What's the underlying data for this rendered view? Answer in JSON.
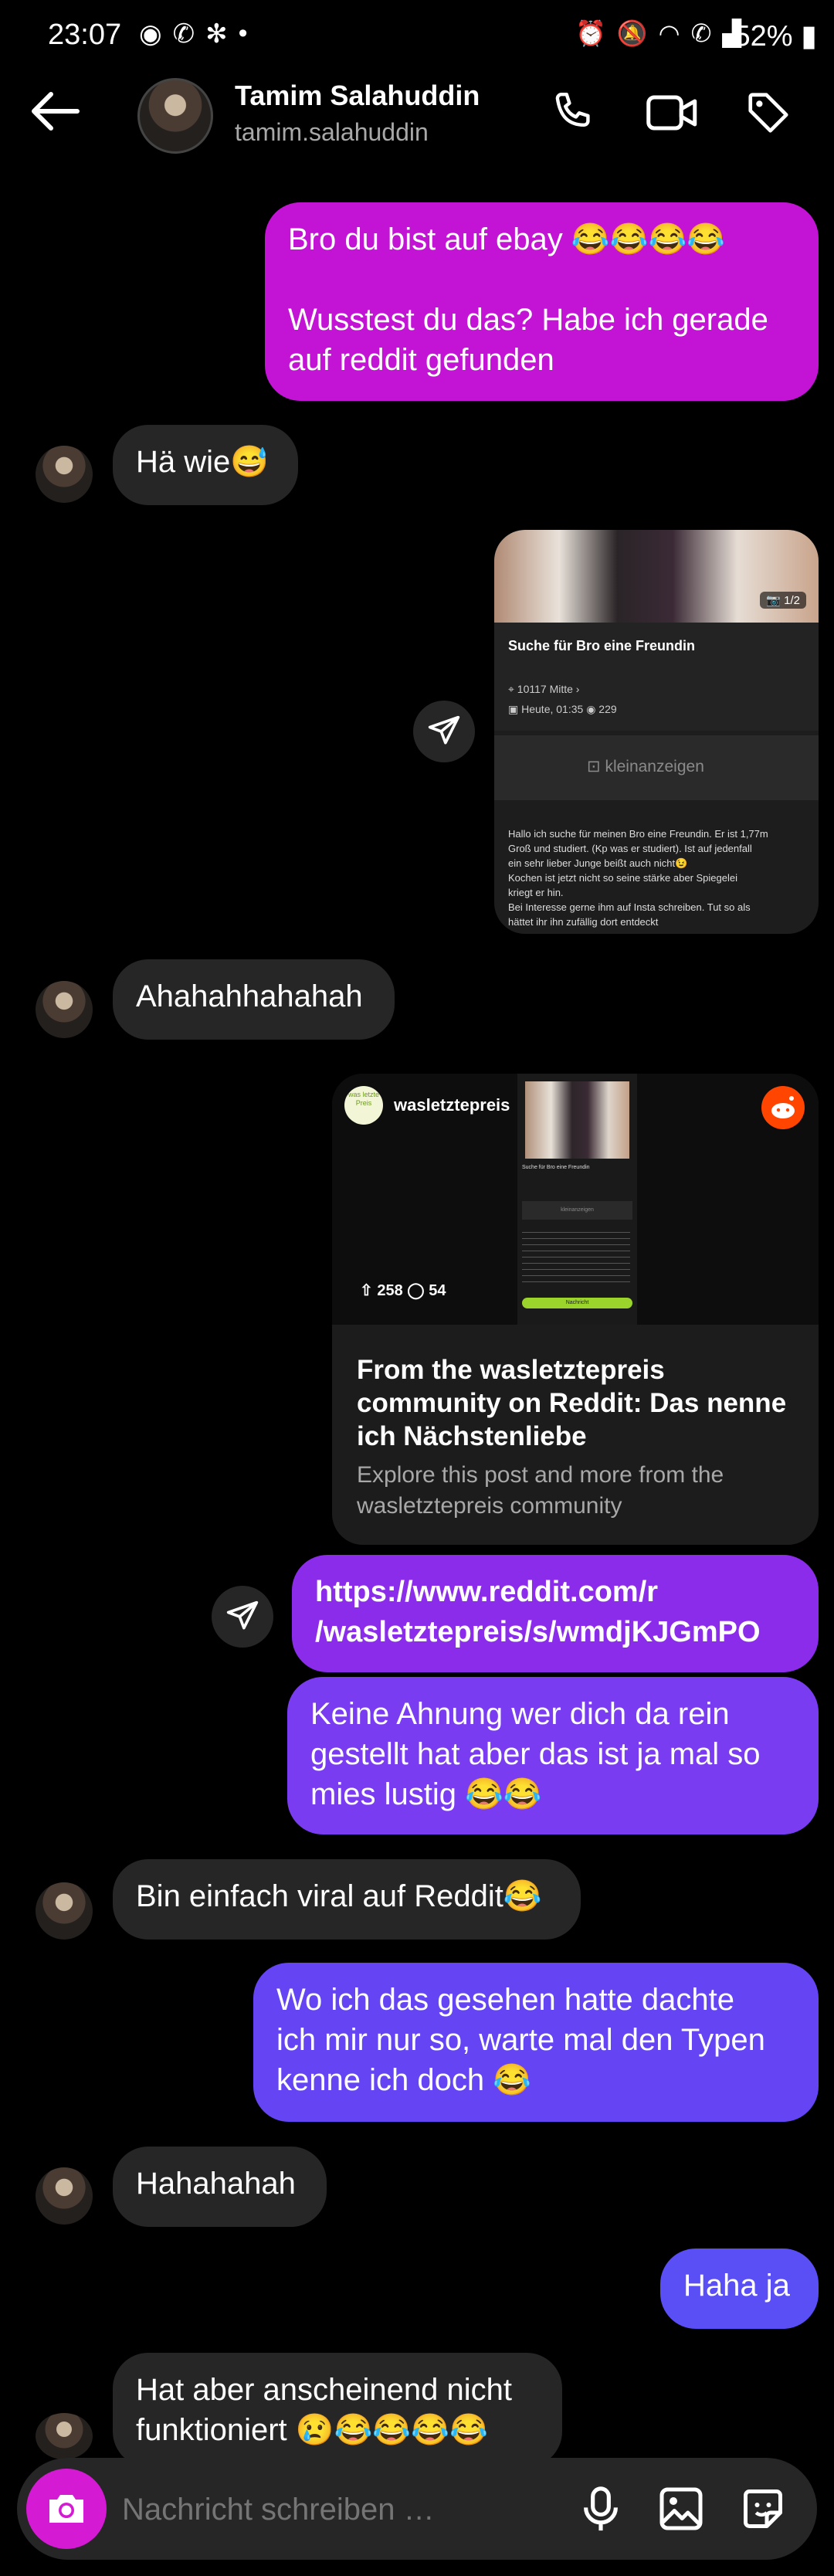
{
  "status_bar": {
    "time": "23:07",
    "battery": "52%"
  },
  "header": {
    "name": "Tamim Salahuddin",
    "username": "tamim.salahuddin"
  },
  "messages": {
    "m1_line1": "Bro du bist auf ebay 😂😂😂😂",
    "m1_line2": "Wusstest du das? Habe ich gerade",
    "m1_line3": "auf reddit gefunden",
    "m2": "Hä wie😅",
    "m3": "Ahahahhahahah",
    "m4_line1": "https://www.reddit.com/r",
    "m4_line2": "/wasletztepreis/s/wmdjKJGmPO",
    "m5_line1": "Keine Ahnung wer dich da rein",
    "m5_line2": "gestellt hat aber das ist ja mal so",
    "m5_line3": "mies lustig 😂😂",
    "m6": "Bin einfach viral auf Reddit😂",
    "m7_line1": "Wo ich das gesehen hatte dachte",
    "m7_line2": "ich mir nur so, warte mal den Typen",
    "m7_line3": "kenne ich doch 😂",
    "m8": "Hahahahah",
    "m9": "Haha ja",
    "m10_line1": "Hat aber anscheinend nicht",
    "m10_line2": "funktioniert 😢😂😂😂😂"
  },
  "ad_card": {
    "photo_counter": "1/2",
    "title": "Suche für Bro eine Freundin",
    "location": "10117 Mitte",
    "date": "Heute, 01:35",
    "views": "229",
    "brand": "kleinanzeigen",
    "body1": "Hallo ich suche für meinen Bro eine Freundin. Er ist 1,77m",
    "body2": "Groß und studiert. (Kp was er studiert). Ist auf jedenfall",
    "body3": "ein sehr lieber Junge beißt auch nicht😉",
    "body4": "Kochen ist jetzt nicht so seine stärke aber Spiegelei",
    "body5": "kriegt er hin.",
    "body6": "Bei Interesse gerne ihm auf Insta schreiben. Tut so als",
    "body7": "hättet ihr ihn zufällig dort entdeckt"
  },
  "reddit_card": {
    "community": "wasletztepreis",
    "community_avatar_text": "was letzte Preis",
    "upvotes": "258",
    "comments": "54",
    "title1": "From the wasletztepreis",
    "title2": "community on Reddit: Das nenne",
    "title3": "ich Nächstenliebe",
    "desc1": "Explore this post and more from the",
    "desc2": "wasletztepreis community",
    "mini_title": "Suche für Bro eine Freundin",
    "mini_brand": "kleinanzeigen",
    "mini_button": "Nachricht"
  },
  "input": {
    "placeholder": "Nachricht schreiben …"
  },
  "colors": {
    "accent_magenta": "#c314d6",
    "accent_purple": "#7a3cf0",
    "accent_blue": "#5a4ef5",
    "incoming_bubble": "#262626",
    "camera_button": "#d41ad2"
  },
  "icons": [
    "signal-app-icon",
    "whatsapp-icon",
    "pinwheel-icon",
    "alarm-icon",
    "mute-icon",
    "wifi-icon",
    "wifi-call-icon",
    "signal-icon",
    "battery-icon",
    "back-arrow-icon",
    "phone-icon",
    "video-icon",
    "tag-icon",
    "share-icon",
    "camera-icon",
    "microphone-icon",
    "gallery-icon",
    "sticker-icon",
    "reddit-icon"
  ]
}
